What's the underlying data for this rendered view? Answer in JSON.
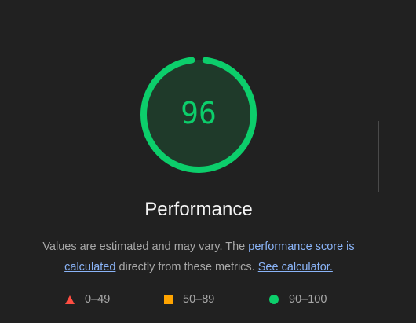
{
  "gauge": {
    "score": "96",
    "fraction": 0.96,
    "color": "#0cce6b",
    "fill_color": "#1f3a2a"
  },
  "category": {
    "title": "Performance"
  },
  "description": {
    "text_before": "Values are estimated and may vary. The ",
    "link_score": "performance score is calculated",
    "text_middle": " directly from these metrics. ",
    "link_calculator": "See calculator."
  },
  "legend": [
    {
      "range": "0–49",
      "shape": "triangle",
      "color": "#ff4e42"
    },
    {
      "range": "50–89",
      "shape": "square",
      "color": "#ffa400"
    },
    {
      "range": "90–100",
      "shape": "circle",
      "color": "#0cce6b"
    }
  ]
}
